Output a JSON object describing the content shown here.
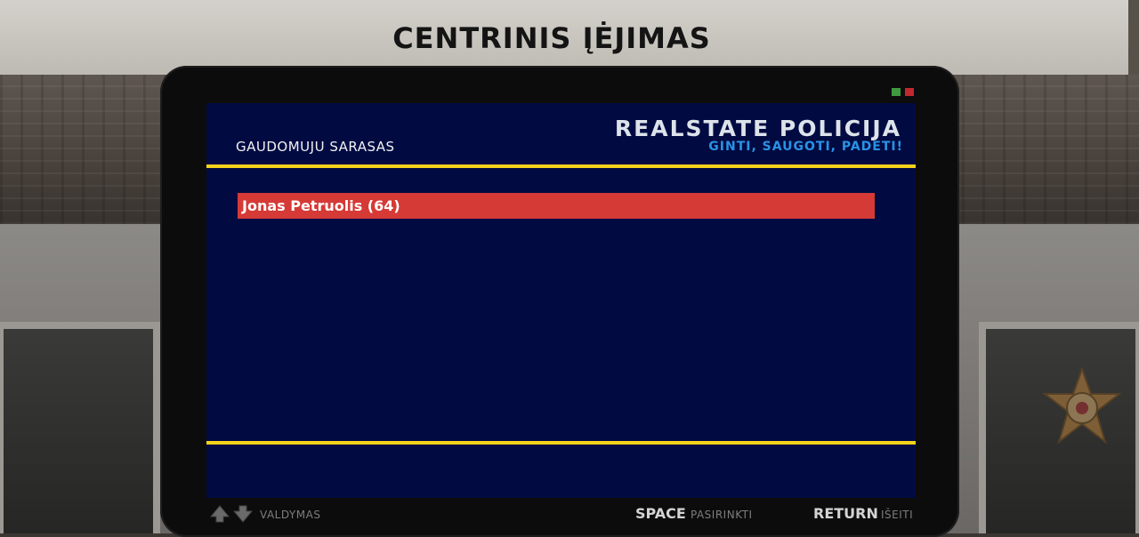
{
  "background": {
    "sign_text": "CENTRINIS ĮĖJIMAS",
    "badge_icon": "sheriff-star-badge"
  },
  "device": {
    "leds": [
      {
        "name": "status-led-green",
        "color": "#3f9a3f"
      },
      {
        "name": "status-led-red",
        "color": "#c0282e"
      }
    ]
  },
  "screen": {
    "title": "GAUDOMUJU SARASAS",
    "brand": "REALSTATE POLICIJA",
    "motto": "GINTI, SAUGOTI, PADETI!",
    "colors": {
      "background": "#010b42",
      "divider": "#f5d21a",
      "selected_row": "#d53a36",
      "motto": "#2a92e6"
    },
    "list": [
      {
        "label": "Jonas Petruolis (64)",
        "selected": true
      }
    ]
  },
  "controls": {
    "navigate_icons": [
      "arrow-up-icon",
      "arrow-down-icon"
    ],
    "navigate_label": "VALDYMAS",
    "select_key": "SPACE",
    "select_label": "PASIRINKTI",
    "exit_key": "RETURN",
    "exit_label": "IŠEITI"
  }
}
